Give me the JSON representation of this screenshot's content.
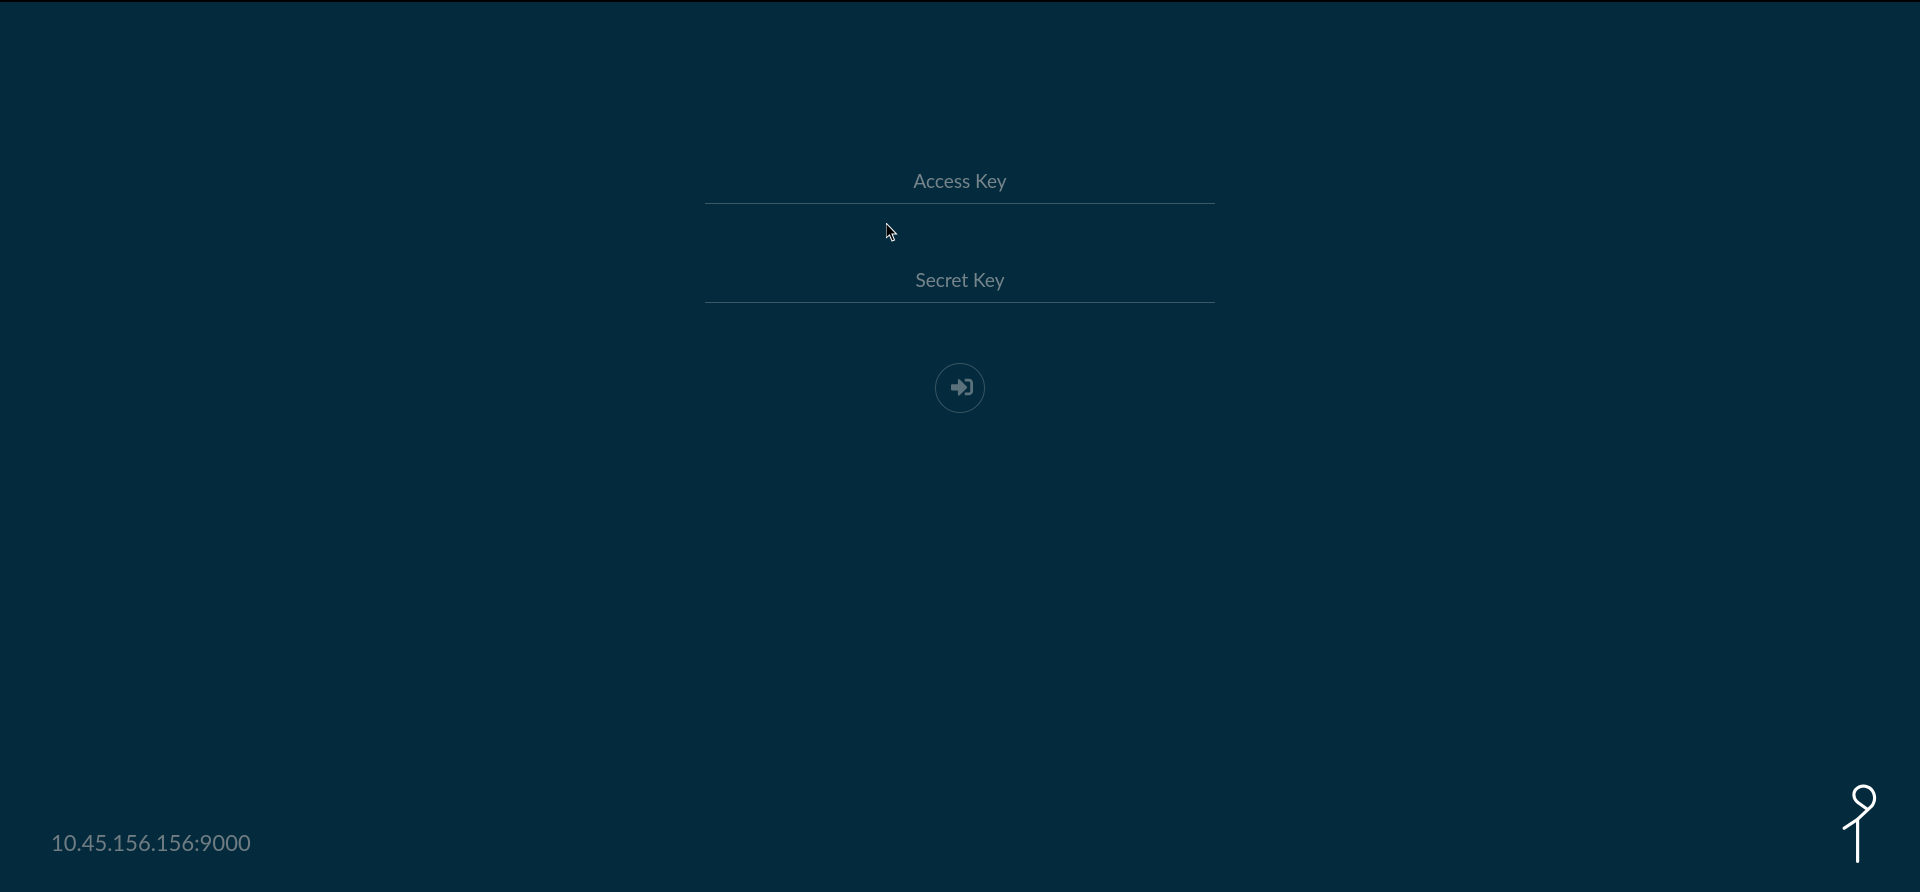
{
  "login": {
    "access_key_placeholder": "Access Key",
    "access_key_value": "",
    "secret_key_placeholder": "Secret Key",
    "secret_key_value": ""
  },
  "footer": {
    "server_address": "10.45.156.156:9000"
  }
}
